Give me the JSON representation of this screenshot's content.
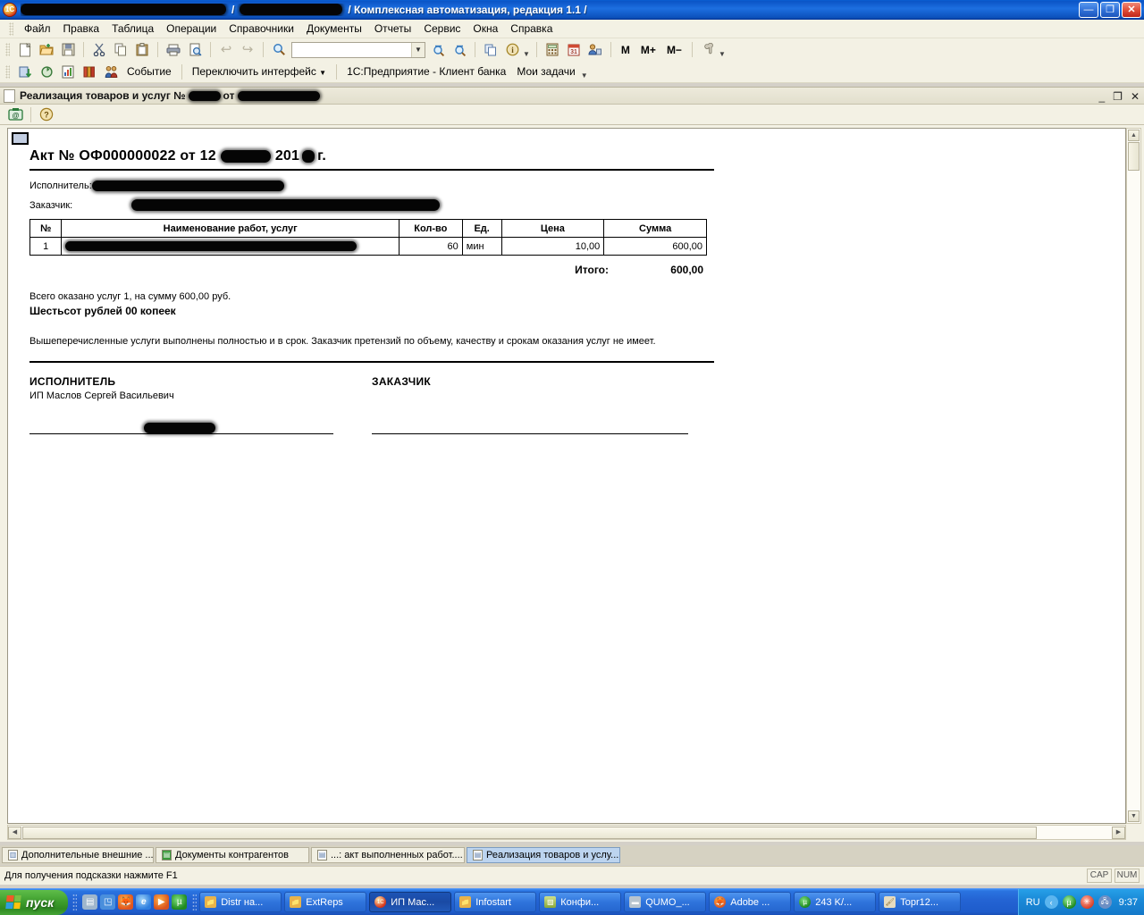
{
  "window": {
    "title_visible": "/ Комплексная автоматизация, редакция 1.1 /",
    "app_icon": "1c-icon",
    "minimize": "—",
    "restore": "❐",
    "close": "✕"
  },
  "menu": [
    {
      "label": "Файл"
    },
    {
      "label": "Правка"
    },
    {
      "label": "Таблица"
    },
    {
      "label": "Операции"
    },
    {
      "label": "Справочники"
    },
    {
      "label": "Документы"
    },
    {
      "label": "Отчеты"
    },
    {
      "label": "Сервис"
    },
    {
      "label": "Окна"
    },
    {
      "label": "Справка"
    }
  ],
  "toolbar_main": {
    "search_value": "",
    "icons": [
      {
        "name": "new-document-icon",
        "glyph": "🗋"
      },
      {
        "name": "open-folder-icon",
        "glyph": "📂"
      },
      {
        "name": "save-icon",
        "glyph": "💾"
      },
      {
        "name": "cut-icon",
        "glyph": "✂"
      },
      {
        "name": "copy-icon",
        "glyph": "⧉"
      },
      {
        "name": "paste-icon",
        "glyph": "📋"
      },
      {
        "name": "print-icon",
        "glyph": "🖶"
      },
      {
        "name": "print-preview-icon",
        "glyph": "🔍"
      },
      {
        "name": "undo-icon",
        "glyph": "↩"
      },
      {
        "name": "redo-icon",
        "glyph": "↪"
      },
      {
        "name": "find-icon",
        "glyph": "🔍"
      },
      {
        "name": "find-next-icon",
        "glyph": "🔎"
      },
      {
        "name": "find-prev-icon",
        "glyph": "🔎"
      },
      {
        "name": "copy-window-icon",
        "glyph": "❐"
      },
      {
        "name": "about-icon",
        "glyph": "i"
      },
      {
        "name": "calculator-icon",
        "glyph": "▦"
      },
      {
        "name": "calendar-icon",
        "glyph": "31"
      },
      {
        "name": "users-icon",
        "glyph": "👤"
      }
    ],
    "memory_buttons": [
      "M",
      "M+",
      "M−"
    ],
    "settings_icon": "wrench-icon"
  },
  "toolbar_secondary": {
    "icons": [
      {
        "name": "exchange-icon",
        "glyph": "⇵"
      },
      {
        "name": "refresh-icon",
        "glyph": "↻"
      },
      {
        "name": "report-icon",
        "glyph": "📊"
      },
      {
        "name": "books-icon",
        "glyph": "📕"
      },
      {
        "name": "contacts-icon",
        "glyph": "👥"
      }
    ],
    "event_label": "Событие",
    "switch_interface_label": "Переключить интерфейс",
    "client_bank_label": "1С:Предприятие - Клиент банка",
    "my_tasks_label": "Мои задачи"
  },
  "mdi_window": {
    "title_prefix": "Реализация товаров и услуг №",
    "title_middle": "от",
    "doc_icon": "document-icon",
    "minimize": "_",
    "restore": "❐",
    "close": "✕",
    "toolbar_icons": [
      {
        "name": "save-print-form-icon",
        "glyph": "@"
      },
      {
        "name": "help-icon",
        "glyph": "?"
      }
    ]
  },
  "document": {
    "title_before": "Акт № ОФ000000022 от 12",
    "title_after": "201",
    "title_suffix": "г.",
    "performer_label": "Исполнитель:",
    "customer_label": "Заказчик:",
    "table": {
      "headers": [
        "№",
        "Наименование работ, услуг",
        "Кол-во",
        "Ед.",
        "Цена",
        "Сумма"
      ],
      "rows": [
        {
          "no": "1",
          "name": "",
          "qty": "60",
          "unit": "мин",
          "price": "10,00",
          "sum": "600,00"
        }
      ],
      "total_label": "Итого:",
      "total_value": "600,00"
    },
    "summary_line": "Всего оказано услуг 1, на сумму 600,00 руб.",
    "amount_in_words": "Шестьсот рублей 00 копеек",
    "disclaimer": "Вышеперечисленные услуги выполнены полностью и в срок. Заказчик претензий по объему, качеству и срокам оказания услуг не имеет.",
    "signatures": {
      "performer_heading": "ИСПОЛНИТЕЛЬ",
      "performer_name": "ИП Маслов Сергей Васильевич",
      "customer_heading": "ЗАКАЗЧИК"
    }
  },
  "window_list": [
    {
      "label": "Дополнительные внешние ...",
      "icon": "table-icon",
      "active": false
    },
    {
      "label": "Документы контрагентов",
      "icon": "green-doc-icon",
      "active": false
    },
    {
      "label": "...: акт выполненных работ....",
      "icon": "report-doc-icon",
      "active": false
    },
    {
      "label": "Реализация товаров и услу...",
      "icon": "document-icon",
      "active": true
    }
  ],
  "statusbar": {
    "hint": "Для получения подсказки нажмите F1",
    "caps": "CAP",
    "num": "NUM"
  },
  "taskbar": {
    "start_label": "пуск",
    "quick_launch": [
      {
        "name": "show-desktop-icon",
        "glyph": "▤",
        "color": "#9fb6cc"
      },
      {
        "name": "media-icon",
        "glyph": "◳",
        "color": "#4a8fdc"
      },
      {
        "name": "firefox-icon",
        "glyph": "🦊",
        "color": "#e06a1e"
      },
      {
        "name": "internet-explorer-icon",
        "glyph": "e",
        "color": "#2f7fe0"
      },
      {
        "name": "media-player-icon",
        "glyph": "▶",
        "color": "#e06a1e"
      },
      {
        "name": "utorrent-icon",
        "glyph": "µ",
        "color": "#2aa32a"
      }
    ],
    "tasks": [
      {
        "label": "Distr на...",
        "icon": "folder-icon",
        "color": "#e8b34a",
        "active": false
      },
      {
        "label": "ExtReps",
        "icon": "folder-icon",
        "color": "#e8b34a",
        "active": false
      },
      {
        "label": "ИП Мас...",
        "icon": "1c-icon",
        "color": "#d4341a",
        "active": true
      },
      {
        "label": "Infostart",
        "icon": "folder-icon",
        "color": "#e8b34a",
        "active": false
      },
      {
        "label": "Конфи...",
        "icon": "image-icon",
        "color": "#b0a030",
        "active": false
      },
      {
        "label": "QUMO_...",
        "icon": "drive-icon",
        "color": "#b8c4cf",
        "active": false
      },
      {
        "label": "Adobe ...",
        "icon": "firefox-icon",
        "color": "#e06a1e",
        "active": false
      },
      {
        "label": "243 K/...",
        "icon": "utorrent-icon",
        "color": "#2aa32a",
        "active": false
      },
      {
        "label": "Topr12...",
        "icon": "paint-icon",
        "color": "#c0a060",
        "active": false
      }
    ],
    "tray": {
      "language": "RU",
      "icons": [
        {
          "name": "show-hidden-icons-icon",
          "glyph": "‹",
          "color": "#5bb5ef"
        },
        {
          "name": "utorrent-tray-icon",
          "glyph": "µ",
          "color": "#2aa32a"
        },
        {
          "name": "antivirus-tray-icon",
          "glyph": "✳",
          "color": "#e8533a"
        },
        {
          "name": "network-tray-icon",
          "glyph": "🖧",
          "color": "#6d8fc4"
        }
      ],
      "clock": "9:37"
    }
  },
  "colors": {
    "title_blue": "#0b55c7",
    "toolbar_bg": "#f3f1e4",
    "active_tab": "#bcd4ef",
    "taskbar_blue": "#2464d4"
  }
}
